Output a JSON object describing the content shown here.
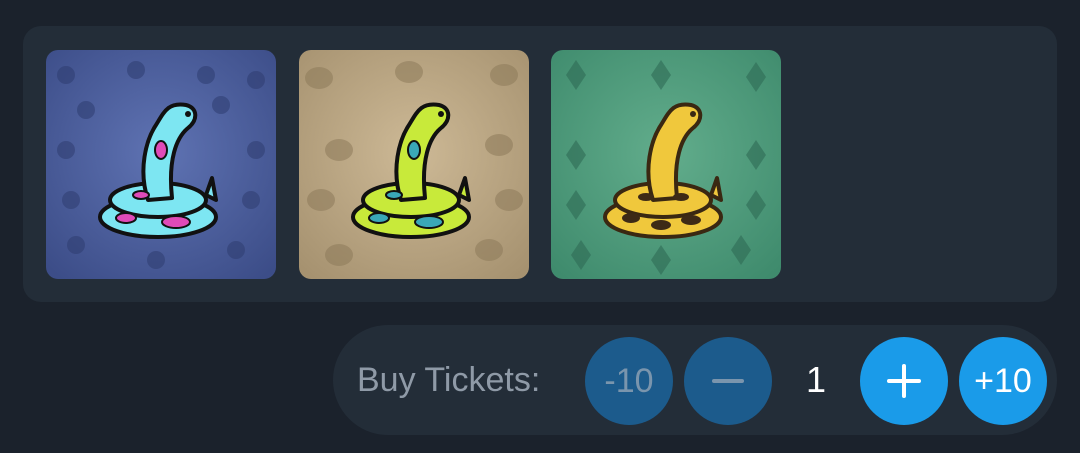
{
  "gallery": {
    "items": [
      {
        "name": "blue-pink snake",
        "bg": "#4a5d9e",
        "accent": "#7de6f2",
        "spots": "#e04ab8"
      },
      {
        "name": "lime snake",
        "bg": "#bca886",
        "accent": "#c8ea3a",
        "spots": "#3aa8b8"
      },
      {
        "name": "golden snake",
        "bg": "#4f9a7c",
        "accent": "#f0c83c",
        "spots": "#3d2a16"
      }
    ]
  },
  "buy": {
    "label": "Buy Tickets:",
    "minus10_label": "-10",
    "quantity": "1",
    "plus10_label": "+10",
    "colors": {
      "dim_button": "#1c5b8c",
      "active_button": "#1a9be9"
    }
  }
}
